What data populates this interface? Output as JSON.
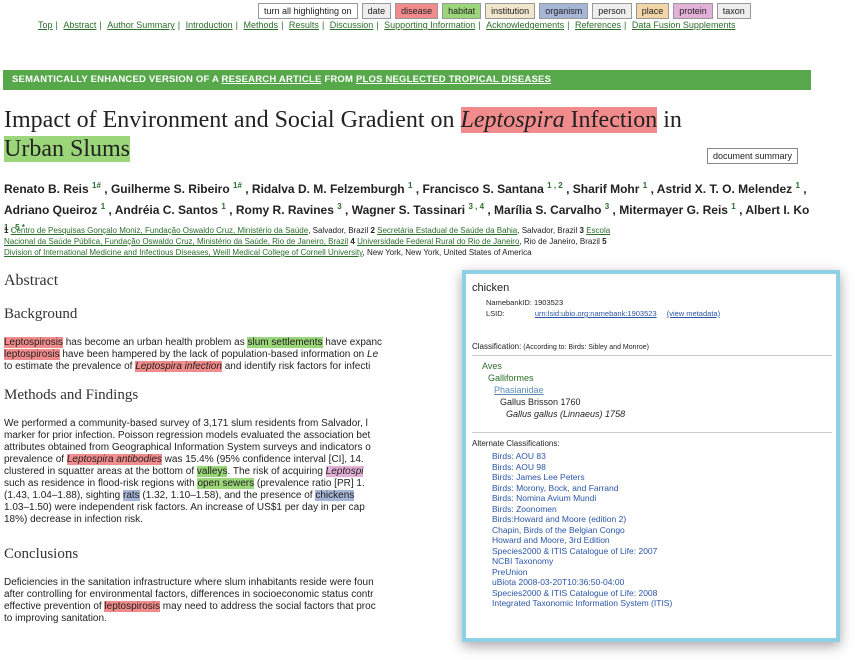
{
  "toolbar": {
    "buttons": [
      {
        "label": "turn all highlighting on",
        "color": "#ffffff"
      },
      {
        "label": "date",
        "color": "#eeeeee"
      },
      {
        "label": "disease",
        "color": "#f28b8b"
      },
      {
        "label": "habitat",
        "color": "#9cd67a"
      },
      {
        "label": "institution",
        "color": "#f0e6cc"
      },
      {
        "label": "organism",
        "color": "#a7b6d7"
      },
      {
        "label": "person",
        "color": "#eeeeee"
      },
      {
        "label": "place",
        "color": "#f3d6a8"
      },
      {
        "label": "protein",
        "color": "#e3b0d8"
      },
      {
        "label": "taxon",
        "color": "#eeeeee"
      }
    ]
  },
  "nav": [
    "Top",
    "Abstract",
    "Author Summary",
    "Introduction",
    "Methods",
    "Results",
    "Discussion",
    "Supporting Information",
    "Acknowledgements",
    "References",
    "Data Fusion Supplements"
  ],
  "banner": {
    "prefix": "SEMANTICALLY ENHANCED VERSION OF A ",
    "link1": "RESEARCH ARTICLE",
    "mid": " FROM ",
    "link2": "PLOS NEGLECTED TROPICAL DISEASES"
  },
  "title": {
    "part1": "Impact of Environment and Social Gradient on ",
    "genus": "Leptospira",
    "part2": " Infection",
    "part3": " in ",
    "part4": "Urban Slums"
  },
  "doc_summary": "document summary",
  "authors": [
    {
      "name": "Renato B. Reis",
      "sup": "1#"
    },
    {
      "name": "Guilherme S. Ribeiro",
      "sup": "1#"
    },
    {
      "name": "Ridalva D. M. Felzemburgh",
      "sup": "1"
    },
    {
      "name": "Francisco S. Santana",
      "sup": "1 , 2"
    },
    {
      "name": "Sharif Mohr",
      "sup": "1"
    },
    {
      "name": "Astrid X. T. O. Melendez",
      "sup": "1"
    },
    {
      "name": "Adriano Queiroz",
      "sup": "1"
    },
    {
      "name": "Andréia C. Santos",
      "sup": "1"
    },
    {
      "name": "Romy R. Ravines",
      "sup": "3"
    },
    {
      "name": "Wagner S. Tassinari",
      "sup": "3 , 4"
    },
    {
      "name": "Marília S. Carvalho",
      "sup": "3"
    },
    {
      "name": "Mitermayer G. Reis",
      "sup": "1"
    },
    {
      "name": "Albert I. Ko",
      "sup": "1 , 5 *"
    }
  ],
  "affiliations": {
    "a1_num": "1",
    "a1": "Centro de Pesquisas Gonçalo Moniz, Fundação Oswaldo Cruz, Ministério da Saúde",
    "a1_place": ", Salvador, Brazil",
    "a2_num": "2",
    "a2": "Secretária Estadual de Saúde da Bahia",
    "a2_place": ", Salvador, Brazil",
    "a3_num": "3",
    "a3a": "Escola",
    "a3b": "Nacional da Saúde Pública, Fundação Oswaldo Cruz, Ministério da Saúde, Rio de Janeiro, Brazil",
    "a4_num": "4",
    "a4": "Universidade Federal Rural do Rio de Janeiro",
    "a4_place": ", Rio de Janeiro, Brazil",
    "a5_num": "5",
    "a5": "Division of International Medicine and Infectious Diseases, Weill Medical College of Cornell University",
    "a5_place": ", New York, New York, United States of America"
  },
  "abstract": {
    "heading": "Abstract",
    "background_heading": "Background",
    "bg1_a": "Leptospirosis",
    "bg1_b": " has become an urban health problem as ",
    "bg1_c": "slum settlements",
    "bg1_d": " have expanc",
    "bg2_a": "leptospirosis",
    "bg2_b": " have been hampered by the lack of population-based information on ",
    "bg2_c": "Le",
    "bg3_a": "to estimate the prevalence of ",
    "bg3_b": "Leptospira infection",
    "bg3_c": " and identify risk factors for infecti",
    "methods_heading": "Methods and Findings",
    "m1": "We performed a community-based survey of 3,171 slum residents from Salvador, l",
    "m2": "marker for prior infection. Poisson regression models evaluated the association bet",
    "m3": "attributes obtained from Geographical Information System surveys and indicators o",
    "m4_a": "prevalence of ",
    "m4_b": "Leptospira antibodies",
    "m4_c": " was 15.4% (95% confidence interval [CI], 14.",
    "m5_a": "clustered in squatter areas at the bottom of ",
    "m5_b": "valleys",
    "m5_c": ". The risk of acquiring ",
    "m5_d": "Leptospi",
    "m6_a": "such as residence in flood-risk regions with ",
    "m6_b": "open sewers",
    "m6_c": " (prevalence ratio [PR] 1.",
    "m7_a": "(1.43, 1.04–1.88), sighting ",
    "m7_b": "rats",
    "m7_c": " (1.32, 1.10–1.58), and the presence of ",
    "m7_d": "chickens",
    "m8": "1.03–1.50) were independent risk factors. An increase of US$1 per day in per cap",
    "m9": "18%) decrease in infection risk.",
    "conclusions_heading": "Conclusions",
    "c1": "Deficiencies in the sanitation infrastructure where slum inhabitants reside were foun",
    "c2": "after controlling for environmental factors, differences in socioeconomic status contr",
    "c3_a": "effective prevention of ",
    "c3_b": "leptospirosis",
    "c3_c": " may need to address the social factors that proc",
    "c4": "to improving sanitation."
  },
  "popup": {
    "title": "chicken",
    "namebank_label": "NamebankID: ",
    "namebank_value": "1903523",
    "lsid_label": "LSID:",
    "lsid_value": "urn:lsid:ubio.org:namebank:1903523",
    "view_metadata": "(view metadata)",
    "classification_label": "Classification:",
    "classification_note": " (According to: Birds: Sibley and Monroe)",
    "tree": [
      "Aves",
      "Galliformes",
      "Phasianidae",
      "Gallus Brisson 1760",
      "Gallus gallus (Linnaeus) 1758"
    ],
    "alt_label": "Alternate Classifications:",
    "alternates": [
      "Birds: AOU 83",
      "Birds: AOU 98",
      "Birds: James Lee Peters",
      "Birds: Morony, Bock, and Farrand",
      "Birds: Nomina Avium Mundi",
      "Birds: Zoonomen",
      "Birds:Howard and Moore (edition 2)",
      "Chapin, Birds of the Belgian Congo",
      "Howard and Moore, 3rd Edition",
      "Species2000 & ITIS Catalogue of Life: 2007",
      "NCBI Taxonomy",
      "PreUnion",
      "uBiota 2008-03-20T10:36:50-04:00",
      "Species2000 & ITIS Catalogue of Life: 2008",
      "Integrated Taxonomic Information System (ITIS)"
    ]
  }
}
